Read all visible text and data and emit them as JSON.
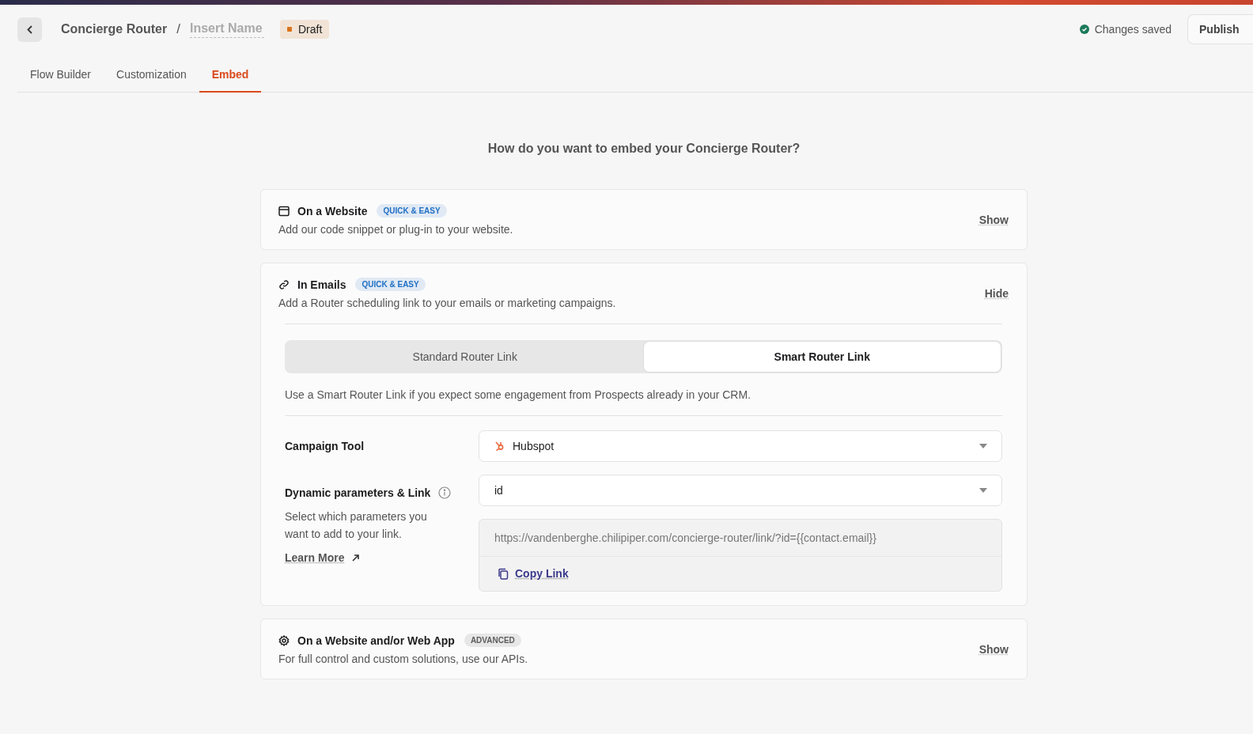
{
  "header": {
    "breadcrumb": "Concierge Router",
    "separator": "/",
    "name_field": {
      "placeholder": "Insert Name"
    },
    "status_badge": "Draft",
    "save_status": "Changes saved",
    "publish_button": "Publish"
  },
  "tabs": [
    {
      "label": "Flow Builder",
      "selected": false
    },
    {
      "label": "Customization",
      "selected": false
    },
    {
      "label": "Embed",
      "selected": true
    }
  ],
  "question": "How do you want to embed your Concierge Router?",
  "sections": [
    {
      "kind": "website",
      "title": "On a Website",
      "badge": "QUICK & EASY",
      "color": "#1f6fc5",
      "description": "Add our code snippet or plug-in to your website.",
      "toggle": "Show"
    },
    {
      "kind": "email",
      "title": "In Emails",
      "badge": "QUICK & EASY",
      "color": "#1f6fc5",
      "description": "Add a Router scheduling link to your emails or marketing campaigns.",
      "toggle": "Hide",
      "options": [
        {
          "label": "Standard Router Link",
          "selected": false
        },
        {
          "label": "Smart Router Link",
          "selected": true
        }
      ],
      "hint": "Use a Smart Router Link if you expect some engagement from Prospects already in your CRM.",
      "campaign_tool": {
        "label": "Campaign Tool",
        "value": "Hubspot"
      },
      "parameters": {
        "label": "Dynamic parameters & Link",
        "help": "Select which parameters you want to add to your link.",
        "learn_more": "Learn More",
        "value": "id",
        "link": "https://vandenberghe.chilipiper.com/concierge-router/link/?id={{contact.email}}",
        "copy": "Copy Link"
      }
    },
    {
      "kind": "api",
      "title": "On a Website and/or Web App",
      "badge": "ADVANCED",
      "color": "#5c5c5c",
      "description": "For full control and custom solutions, use our APIs.",
      "toggle": "Show"
    }
  ]
}
